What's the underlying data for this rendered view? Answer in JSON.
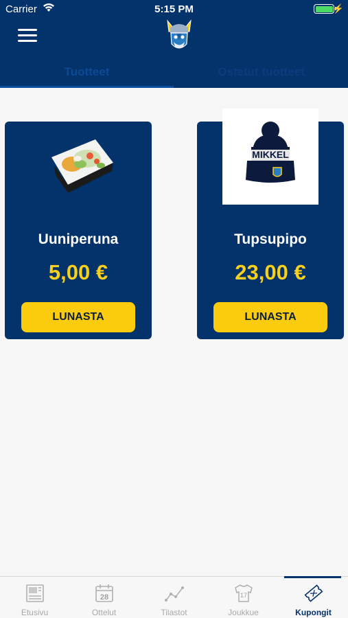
{
  "status_bar": {
    "carrier": "Carrier",
    "time": "5:15 PM"
  },
  "header": {
    "logo_icon": "viking-mascot-logo",
    "menu_icon": "hamburger-menu-icon"
  },
  "tabs": [
    {
      "label": "Tuotteet",
      "active": true
    },
    {
      "label": "Ostetut tuotteet",
      "active": false
    }
  ],
  "products": [
    {
      "name": "Uuniperuna",
      "price": "5,00 €",
      "button": "LUNASTA",
      "image_icon": "baked-potato-image"
    },
    {
      "name": "Tupsupipo",
      "price": "23,00 €",
      "button": "LUNASTA",
      "image_icon": "beanie-hat-image",
      "hat_text": "MIKKEL"
    }
  ],
  "tabbar": [
    {
      "label": "Etusivu",
      "icon": "home-news-icon",
      "active": false
    },
    {
      "label": "Ottelut",
      "icon": "calendar-icon",
      "calendar_day": "28",
      "active": false
    },
    {
      "label": "Tilastot",
      "icon": "stats-line-icon",
      "active": false
    },
    {
      "label": "Joukkue",
      "icon": "jersey-icon",
      "jersey_number": "17",
      "active": false
    },
    {
      "label": "Kupongit",
      "icon": "coupon-icon",
      "active": true
    }
  ],
  "colors": {
    "navy": "#04326b",
    "accent_yellow": "#fbcc0e",
    "price_yellow": "#f7cf1d"
  }
}
